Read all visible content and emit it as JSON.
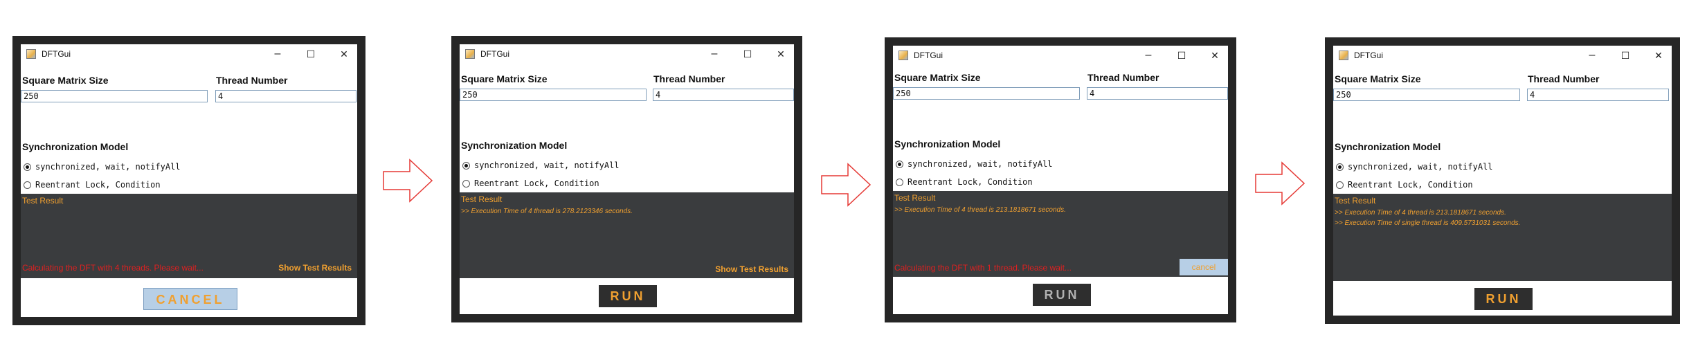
{
  "window": {
    "title": "DFTGui",
    "minimize_glyph": "–",
    "maximize_glyph": "☐",
    "close_glyph": "✕"
  },
  "labels": {
    "matrix_size": "Square Matrix Size",
    "thread_number": "Thread Number",
    "sync_model": "Synchronization Model",
    "option_synchronized": "synchronized, wait, notifyAll",
    "option_reentrant": "Reentrant Lock, Condition",
    "test_result": "Test Result",
    "show_results": "Show Test Results",
    "small_cancel": "cancel"
  },
  "panels": [
    {
      "matrix_size": "250",
      "thread_number": "4",
      "selected_option": "synchronized",
      "log_lines": [],
      "status_message": "Calculating the DFT with 4 threads. Please wait...",
      "show_results_button": true,
      "small_cancel_button": false,
      "bottom_button": "CANCEL"
    },
    {
      "matrix_size": "250",
      "thread_number": "4",
      "selected_option": "synchronized",
      "log_lines": [
        ">> Execution Time of 4 thread is 278.2123346 seconds."
      ],
      "status_message": "",
      "show_results_button": true,
      "small_cancel_button": false,
      "bottom_button": "RUN"
    },
    {
      "matrix_size": "250",
      "thread_number": "4",
      "selected_option": "synchronized",
      "log_lines": [
        ">> Execution Time of 4 thread is 213.1818671 seconds."
      ],
      "status_message": "Calculating the DFT with 1 thread. Please wait...",
      "show_results_button": false,
      "small_cancel_button": true,
      "bottom_button": "RUN"
    },
    {
      "matrix_size": "250",
      "thread_number": "4",
      "selected_option": "synchronized",
      "log_lines": [
        ">> Execution Time of 4 thread is 213.1818671 seconds.",
        ">> Execution Time of single thread is 409.5731031 seconds."
      ],
      "status_message": "",
      "show_results_button": false,
      "small_cancel_button": false,
      "bottom_button": "RUN"
    }
  ],
  "colors": {
    "accent_orange": "#f0a030",
    "status_red": "#e02020",
    "panel_dark": "#3a3c3e",
    "frame": "#262626"
  }
}
